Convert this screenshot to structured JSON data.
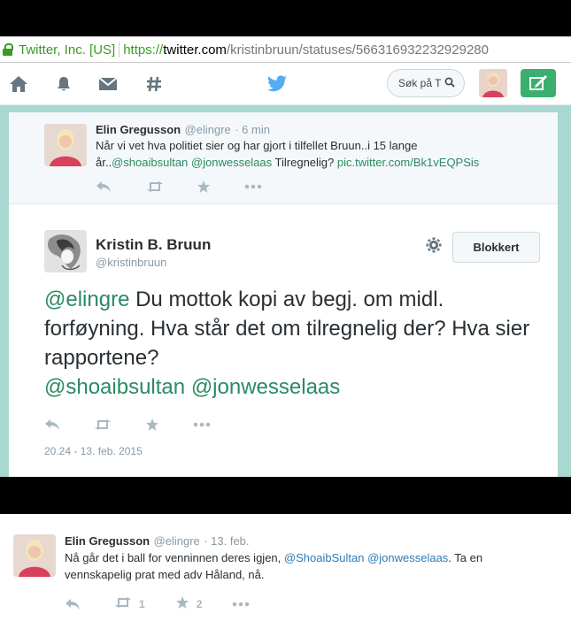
{
  "browser": {
    "site_identity": "Twitter, Inc. [US]",
    "url_protocol": "https://",
    "url_host": "twitter.com",
    "url_path": "/kristinbruun/statuses/566316932232929280"
  },
  "nav": {
    "icons": [
      "home-icon",
      "notifications-icon",
      "messages-icon",
      "discover-icon",
      "twitter-bird-icon"
    ],
    "search_placeholder": "Søk på T",
    "accent_color": "#3aaf6f"
  },
  "parent_tweet": {
    "name": "Elin Gregusson",
    "handle": "@elingre",
    "time": "· 6 min",
    "text_line1": "Når vi vet hva politiet sier og har gjort i tilfellet Bruun..i 15 lange",
    "text_line2_prefix": "år..",
    "mention1": "@shoaibsultan",
    "mention2": "@jonwesselaas",
    "text_line2_mid": "Tilregnelig?",
    "pic_link": "pic.twitter.com/Bk1vEQPSis"
  },
  "main_tweet": {
    "name": "Kristin B. Bruun",
    "handle": "@kristinbruun",
    "block_label": "Blokkert",
    "mention_lead": "@elingre",
    "text": " Du mottok kopi av begj. om midl. forføyning. Hva står det om tilregnelig der? Hva sier rapportene?",
    "mention_a": "@shoaibsultan",
    "mention_b": "@jonwesselaas",
    "timestamp": "20.24 - 13. feb. 2015"
  },
  "reply_tweet": {
    "name": "Elin Gregusson",
    "handle": "@elingre",
    "date": "· 13. feb.",
    "text_prefix": "Nå går det i ball for venninnen deres igjen,",
    "mention1": "@ShoaibSultan",
    "mention2": "@jonwesselaas",
    "text_suffix": ". Ta en",
    "text_line2": "vennskapelig prat med adv Håland, nå.",
    "retweets": "1",
    "favorites": "2"
  }
}
